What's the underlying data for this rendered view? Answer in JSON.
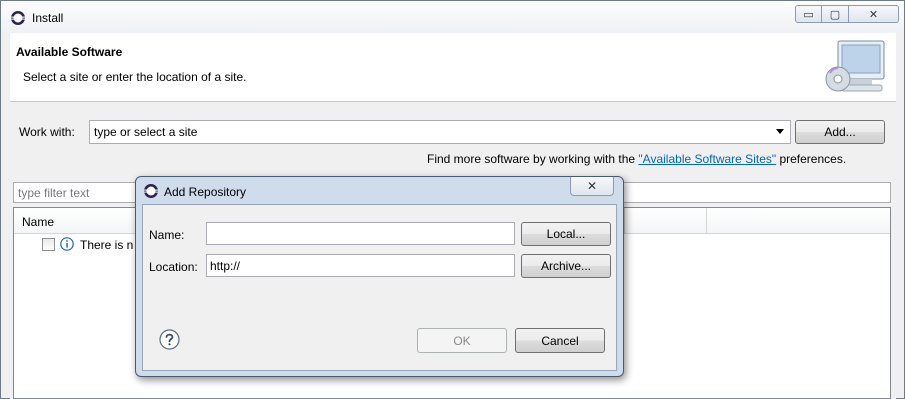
{
  "window": {
    "title": "Install",
    "icon": "eclipse-icon",
    "controls": {
      "minimize": "▭",
      "maximize": "▢",
      "close": "✕"
    }
  },
  "banner": {
    "title": "Available Software",
    "subtitle": "Select a site or enter the location of a site.",
    "image": "monitor-cd-icon"
  },
  "work_with": {
    "label": "Work with:",
    "value": "type or select a site",
    "add_button": "Add..."
  },
  "find_more": {
    "prefix": "Find more software by working with the ",
    "link": "\"Available Software Sites\"",
    "suffix": " preferences."
  },
  "filter": {
    "placeholder": "type filter text"
  },
  "table": {
    "columns": [
      "Name"
    ],
    "rows": [
      {
        "icon": "info-icon",
        "text": "There is n",
        "checked": false
      }
    ]
  },
  "dialog": {
    "title": "Add Repository",
    "close": "✕",
    "name_label": "Name:",
    "name_value": "",
    "location_label": "Location:",
    "location_value": "http://",
    "local_button": "Local...",
    "archive_button": "Archive...",
    "ok_button": "OK",
    "cancel_button": "Cancel",
    "help_icon": "help-icon"
  },
  "colors": {
    "link": "#0066cc",
    "dialog_frame": "#cfdcec",
    "window_bg": "#f0f0f0"
  }
}
